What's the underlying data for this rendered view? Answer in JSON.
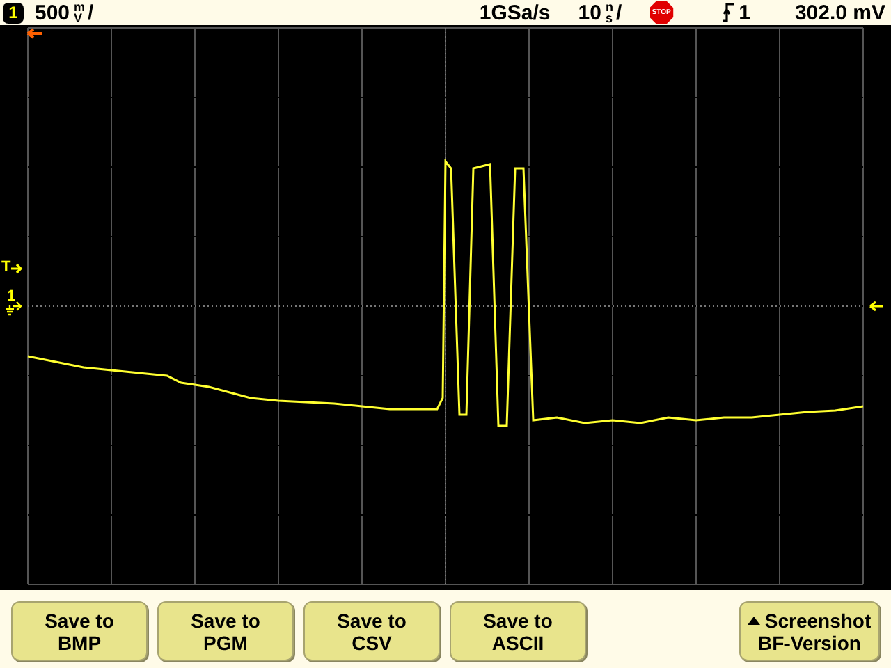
{
  "status_bar": {
    "channel": "1",
    "volts_per_div": {
      "value": "500",
      "prefix": "m",
      "unit": "V",
      "suffix": "/"
    },
    "sample_rate": "1GSa/s",
    "time_per_div": {
      "value": "10",
      "prefix": "n",
      "unit": "s",
      "suffix": "/"
    },
    "run_state": "STOP",
    "trigger_source": "1",
    "trigger_level": "302.0 mV"
  },
  "screen": {
    "trigger_marker": "T",
    "channel_marker": "1"
  },
  "softkeys": [
    {
      "kind": "plain",
      "lines": [
        "Save to",
        "BMP"
      ]
    },
    {
      "kind": "plain",
      "lines": [
        "Save to",
        "PGM"
      ]
    },
    {
      "kind": "plain",
      "lines": [
        "Save to",
        "CSV"
      ]
    },
    {
      "kind": "plain",
      "lines": [
        "Save to",
        "ASCII"
      ]
    },
    {
      "kind": "spacer"
    },
    {
      "kind": "menu",
      "lines": [
        "Screenshot",
        "BF-Version"
      ]
    }
  ]
}
